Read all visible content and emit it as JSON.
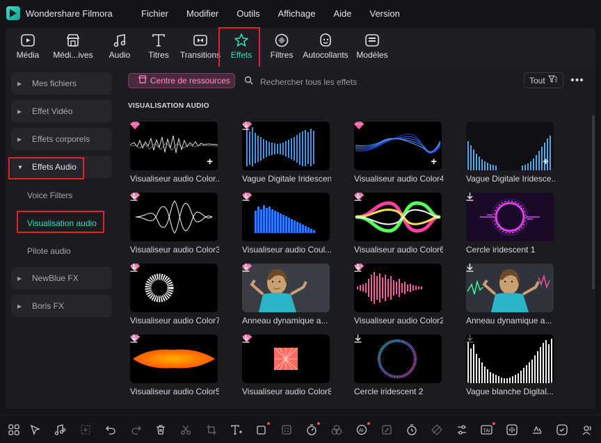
{
  "app": {
    "title": "Wondershare Filmora"
  },
  "menu": [
    "Fichier",
    "Modifier",
    "Outils",
    "Affichage",
    "Aide",
    "Version"
  ],
  "toolbar": {
    "items": [
      {
        "label": "Média",
        "icon": "media-icon"
      },
      {
        "label": "Médi...ives",
        "icon": "stock-media-icon"
      },
      {
        "label": "Audio",
        "icon": "music-note-icon"
      },
      {
        "label": "Titres",
        "icon": "text-icon"
      },
      {
        "label": "Transitions",
        "icon": "transitions-icon"
      },
      {
        "label": "Effets",
        "icon": "effects-icon",
        "active": true
      },
      {
        "label": "Filtres",
        "icon": "filters-icon"
      },
      {
        "label": "Autocollants",
        "icon": "stickers-icon"
      },
      {
        "label": "Modèles",
        "icon": "templates-icon"
      }
    ],
    "accent": "#34e0c2"
  },
  "sidebar": {
    "categories": [
      {
        "label": "Mes fichiers"
      },
      {
        "label": "Effet Vidéo"
      },
      {
        "label": "Effets corporels"
      },
      {
        "label": "Effets Audio",
        "expanded": true
      },
      {
        "label": "NewBlue FX"
      },
      {
        "label": "Boris FX"
      }
    ],
    "subitems": [
      {
        "label": "Voice Filters"
      },
      {
        "label": "Visualisation audio",
        "selected": true
      },
      {
        "label": "Pilote audio"
      }
    ]
  },
  "content": {
    "resource_button": "Centre de ressources",
    "search_placeholder": "Rechercher tous les effets",
    "filter_label": "Tout",
    "more_label": "•••",
    "section_title": "VISUALISATION AUDIO",
    "cards": [
      {
        "name": "Visualiseur audio Color...",
        "action": "add"
      },
      {
        "name": "Vague Digitale Iridescent...",
        "action": "download"
      },
      {
        "name": "Visualiseur audio Color4",
        "action": "add"
      },
      {
        "name": "Vague Digitale Iridesce...",
        "action": "add"
      },
      {
        "name": "Visualiseur audio Color3",
        "action": "download"
      },
      {
        "name": "Visualiseur audio Coul...",
        "action": "download"
      },
      {
        "name": "Visualiseur audio Color6",
        "action": "download"
      },
      {
        "name": "Cercle iridescent 1",
        "action": "download"
      },
      {
        "name": "Visualiseur audio Color7",
        "action": "download"
      },
      {
        "name": "Anneau dynamique a...",
        "action": "download"
      },
      {
        "name": "Visualiseur audio Color2",
        "action": "download"
      },
      {
        "name": "Anneau dynamique a...",
        "action": "download"
      },
      {
        "name": "Visualiseur audio Color5",
        "action": "download"
      },
      {
        "name": "Visualiseur audio Color8",
        "action": "download"
      },
      {
        "name": "Cercle iridescent 2",
        "action": "download"
      },
      {
        "name": "Vague blanche Digital...",
        "action": "download"
      }
    ]
  },
  "bottombar": {
    "icons": [
      "grid-icon",
      "select-arrow-icon",
      "audio-icon",
      "crop-disabled-icon",
      "undo-icon",
      "redo-icon",
      "delete-icon",
      "cut-icon",
      "crop-icon",
      "text-tool-icon",
      "shape-icon",
      "color-icon",
      "speed-icon",
      "mask-icon",
      "ai-portrait-icon",
      "ai-edit-icon",
      "timer-icon",
      "keyframe-icon",
      "adjust-icon",
      "ai-text-icon",
      "audio-wave-icon",
      "track-icon",
      "snap-icon",
      "voice-icon"
    ]
  }
}
